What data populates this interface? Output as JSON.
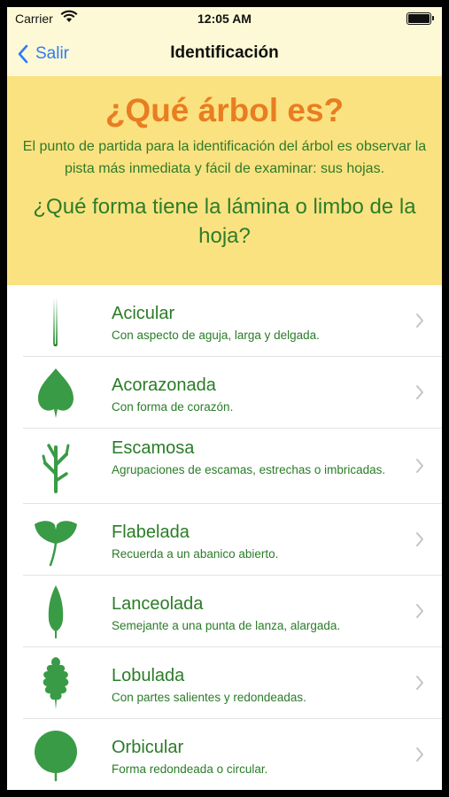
{
  "status": {
    "carrier": "Carrier",
    "time": "12:05 AM"
  },
  "nav": {
    "back_label": "Salir",
    "title": "Identificación"
  },
  "header": {
    "title": "¿Qué árbol es?",
    "intro": "El punto de partida para la identificación del árbol es observar la pista más inmediata y fácil de examinar: sus hojas.",
    "question": "¿Qué forma tiene la lámina o limbo de la hoja?"
  },
  "colors": {
    "accent": "#2d7cf6",
    "header_bg": "#fbe280",
    "title": "#e87d22",
    "green": "#2a7c27",
    "leaf": "#3a9b46"
  },
  "items": [
    {
      "name": "Acicular",
      "desc": "Con aspecto de aguja, larga y delgada.",
      "icon": "needle-leaf-icon"
    },
    {
      "name": "Acorazonada",
      "desc": "Con forma de corazón.",
      "icon": "heart-leaf-icon"
    },
    {
      "name": "Escamosa",
      "desc": "Agrupaciones de escamas, estrechas o imbricadas.",
      "icon": "scale-leaf-icon"
    },
    {
      "name": "Flabelada",
      "desc": "Recuerda a un abanico abierto.",
      "icon": "fan-leaf-icon"
    },
    {
      "name": "Lanceolada",
      "desc": "Semejante a una punta de lanza, alargada.",
      "icon": "lance-leaf-icon"
    },
    {
      "name": "Lobulada",
      "desc": "Con partes salientes y redondeadas.",
      "icon": "lobed-leaf-icon"
    },
    {
      "name": "Orbicular",
      "desc": "Forma redondeada o circular.",
      "icon": "round-leaf-icon"
    }
  ]
}
